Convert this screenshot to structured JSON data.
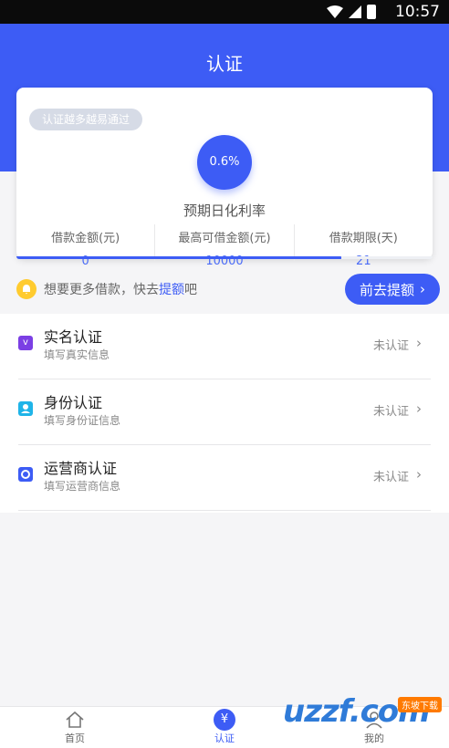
{
  "status_bar": {
    "time": "10:57"
  },
  "header": {
    "title": "认证"
  },
  "card": {
    "tag": "认证越多越易通过",
    "rate": "0.6%",
    "rate_label": "预期日化利率",
    "stats": [
      {
        "label": "借款金额(元)",
        "value": "0"
      },
      {
        "label": "最高可借金额(元)",
        "value": "10000"
      },
      {
        "label": "借款期限(天)",
        "value": "21"
      }
    ],
    "progress_fraction": 0.78
  },
  "notice": {
    "prefix": "想要更多借款，快去",
    "highlight": "提额",
    "suffix": "吧"
  },
  "go_button": {
    "label": "前去提额",
    "chevron": "›"
  },
  "auth_items": [
    {
      "name": "实名认证",
      "sub": "填写真实信息",
      "state": "未认证",
      "icon": "v-icon",
      "color": "#7b3fe4"
    },
    {
      "name": "身份认证",
      "sub": "填写身份证信息",
      "state": "未认证",
      "icon": "id-person-icon",
      "color": "#1fb4e8"
    },
    {
      "name": "运营商认证",
      "sub": "填写运营商信息",
      "state": "未认证",
      "icon": "operator-icon",
      "color": "#3d5cf5"
    }
  ],
  "tabbar": {
    "tabs": [
      {
        "label": "首页",
        "icon": "home-icon"
      },
      {
        "label": "认证",
        "icon": "yen-icon",
        "glyph": "¥"
      },
      {
        "label": "我的",
        "icon": "user-icon"
      }
    ]
  },
  "watermark": {
    "logo": "uzzf.com",
    "tag": "东坡下载"
  },
  "colors": {
    "primary": "#3d5cf5",
    "bell": "#ffcb2f",
    "muted": "#888888"
  }
}
